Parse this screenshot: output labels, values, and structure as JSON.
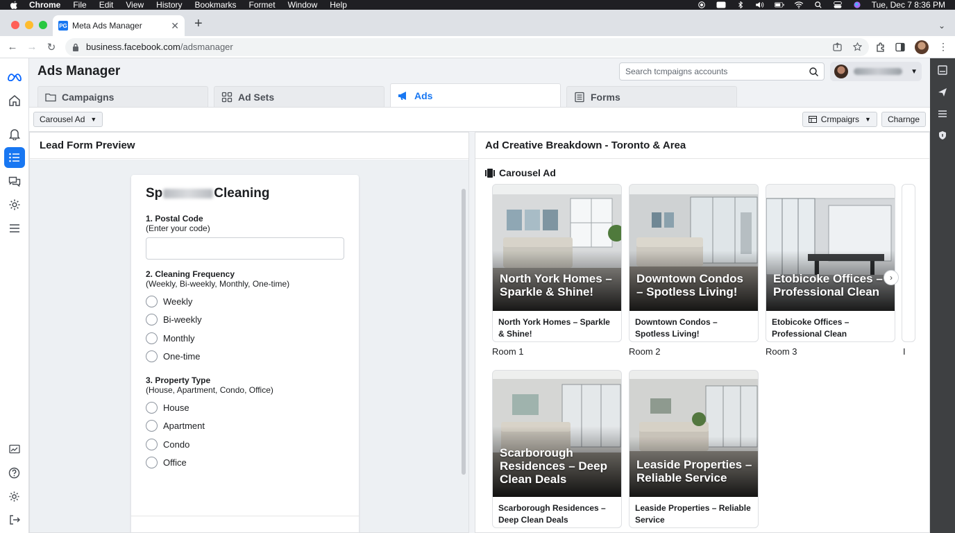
{
  "menubar": {
    "items": [
      "Chrome",
      "File",
      "Edit",
      "View",
      "History",
      "Bookmarks",
      "Formet",
      "Window",
      "Help"
    ],
    "clock": "Tue, Dec 7  8:36 PM"
  },
  "browser": {
    "tab_title": "Meta Ads Manager",
    "tab_favicon": "PG",
    "url_domain": "business.facebook.com",
    "url_path": "/adsmanager"
  },
  "app": {
    "title": "Ads Manager",
    "search_placeholder": "Search tcmpaigns accounts",
    "tabs": [
      {
        "label": "Campaigns",
        "icon": "folder-icon"
      },
      {
        "label": "Ad Sets",
        "icon": "grid-icon"
      },
      {
        "label": "Ads",
        "icon": "megaphone-icon",
        "active": true
      },
      {
        "label": "Forms",
        "icon": "form-icon"
      }
    ],
    "filter_dropdown": "Carousel Ad",
    "campaigns_dropdown": "Crmpaigrs",
    "change_button": "Charnge"
  },
  "lead_form": {
    "panel_title": "Lead Form Preview",
    "brand_prefix": "Sp",
    "brand_suffix": "Cleaning",
    "q1_title": "1. Postal Code",
    "q1_hint": "(Enter your code)",
    "q2_title": "2. Cleaning Frequency",
    "q2_hint": "(Weekly, Bi-weekly, Monthly, One-time)",
    "q2_options": [
      "Weekly",
      "Bi-weekly",
      "Monthly",
      "One-time"
    ],
    "q3_title": "3. Property Type",
    "q3_hint": "(House, Apartment, Condo, Office)",
    "q3_options": [
      "House",
      "Apartment",
      "Condo",
      "Office"
    ]
  },
  "creative": {
    "panel_title": "Ad Creative Breakdown - Toronto & Area",
    "section_label": "Carousel Ad",
    "cards": [
      {
        "overlay": "North York Homes – Sparkle & Shine!",
        "caption": "North York Homes – Sparkle & Shine!",
        "room": "Room 1"
      },
      {
        "overlay": "Downtown Condos – Spotless Living!",
        "caption": "Downtown Condos – Spotless Living!",
        "room": "Room 2"
      },
      {
        "overlay": "Etobicoke Offices – Professional Clean",
        "caption": "Etobicoke Offices – Professional Clean",
        "room": "Room 3"
      },
      {
        "overlay": "Scarborough Residences – Deep Clean Deals",
        "caption": "Scarborough Residences – Deep Clean Deals",
        "room": ""
      },
      {
        "overlay": "Leaside Properties – Reliable Service",
        "caption": "Leaside Properties – Reliable Service",
        "room": ""
      }
    ],
    "peek_room": "I"
  },
  "colors": {
    "accent": "#1877f2",
    "rail_dark": "#3e4042"
  }
}
